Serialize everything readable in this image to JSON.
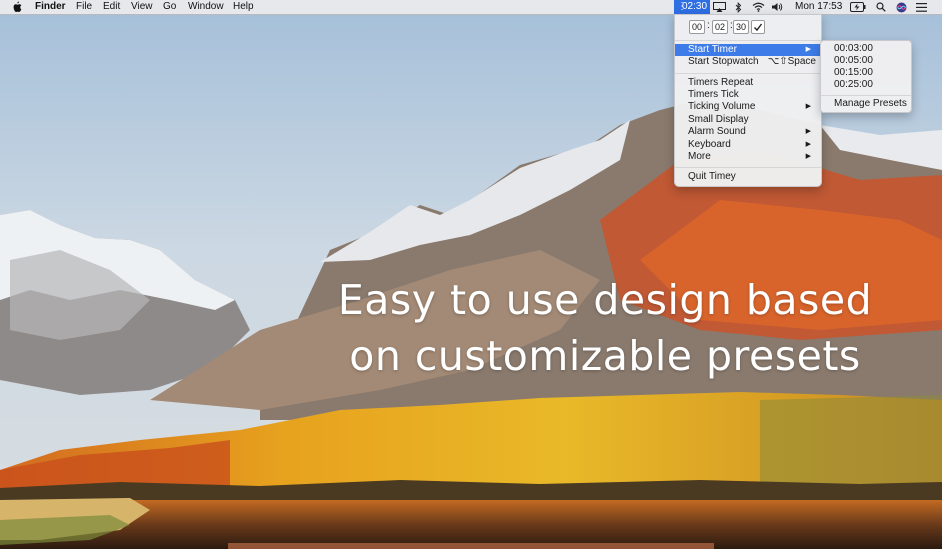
{
  "menubar": {
    "app_name": "Finder",
    "menus": [
      "File",
      "Edit",
      "View",
      "Go",
      "Window",
      "Help"
    ],
    "timey_badge": "02:30",
    "clock": "Mon 17:53"
  },
  "timey_menu": {
    "timer_fields": {
      "hours": "00",
      "minutes": "02",
      "seconds": "30",
      "separator": ":"
    },
    "items": [
      {
        "label": "Start Timer",
        "submenu": true,
        "highlighted": true
      },
      {
        "label": "Start Stopwatch",
        "shortcut": "⌥⇧Space"
      },
      {
        "label": "Timers Repeat"
      },
      {
        "label": "Timers Tick"
      },
      {
        "label": "Ticking Volume",
        "submenu": true
      },
      {
        "label": "Small Display"
      },
      {
        "label": "Alarm Sound",
        "submenu": true
      },
      {
        "label": "Keyboard",
        "submenu": true
      },
      {
        "label": "More",
        "submenu": true
      },
      {
        "label": "Quit Timey"
      }
    ],
    "arrow_glyph": "▶"
  },
  "timer_submenu": {
    "presets": [
      "00:03:00",
      "00:05:00",
      "00:15:00",
      "00:25:00"
    ],
    "manage_label": "Manage Presets"
  },
  "headline": {
    "line1": "Easy to use design based",
    "line2": "on customizable presets"
  },
  "colors": {
    "highlight": "#3d7ce8",
    "timey_badge": "#2f6fe4"
  }
}
